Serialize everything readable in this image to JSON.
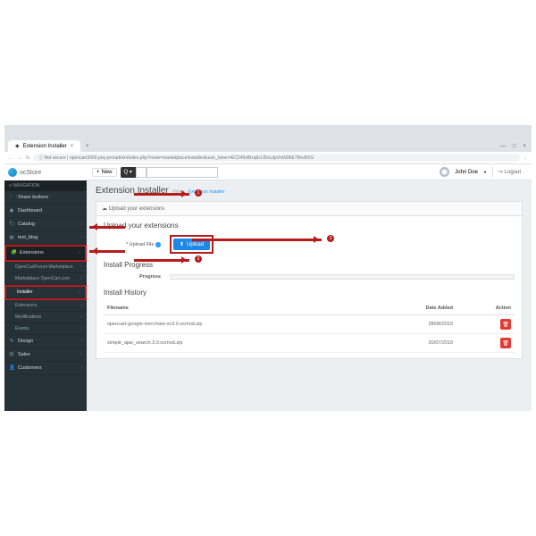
{
  "browser": {
    "tab_title": "Extension Installer",
    "not_secure": "Not secure",
    "url": "opencart3000.pixy.pro/admin/index.php?route=marketplace/installer&user_token=EC245vBixq6cLf5nLdpVmN9hE7IfnvBXG"
  },
  "logo": "ocStore",
  "topbar": {
    "new": "New",
    "user": "John Doe",
    "logout": "Logout"
  },
  "sidebar": {
    "header": "NAVIGATION",
    "items": [
      {
        "icon": "⋮⋮",
        "label": "Share buttons"
      },
      {
        "icon": "◉",
        "label": "Dashboard"
      },
      {
        "icon": "🏷",
        "label": "Catalog"
      },
      {
        "icon": "▤",
        "label": "text_blog"
      },
      {
        "icon": "🧩",
        "label": "Extensions"
      },
      {
        "icon": "✎",
        "label": "Design"
      },
      {
        "icon": "🛒",
        "label": "Sales"
      },
      {
        "icon": "👤",
        "label": "Customers"
      }
    ],
    "subs": [
      {
        "label": "OpenCartForum Marketplace"
      },
      {
        "label": "Marketplace OpenCart.com"
      },
      {
        "label": "Installer"
      },
      {
        "label": "Extensions"
      },
      {
        "label": "Modifications"
      },
      {
        "label": "Events"
      }
    ]
  },
  "page": {
    "title": "Extension Installer",
    "crumb_home": "Home",
    "crumb_current": "Extension Installer",
    "panel_header": "Upload your extensions",
    "upload_section": "Upload your extensions",
    "upload_label": "* Upload File",
    "upload_btn": "Upload",
    "progress_section": "Install Progress",
    "progress_label": "Progress",
    "history_section": "Install History",
    "th_filename": "Filename",
    "th_date": "Date Added",
    "th_action": "Action",
    "rows": [
      {
        "filename": "opencart-google-merchant-oc3.0.ocmod.zip",
        "date": "28/08/2019"
      },
      {
        "filename": "simple_ajax_search.3.0.ocmod.zip",
        "date": "20/07/2019"
      }
    ]
  },
  "annotations": {
    "n1": "1",
    "n2": "2",
    "n3": "3"
  }
}
